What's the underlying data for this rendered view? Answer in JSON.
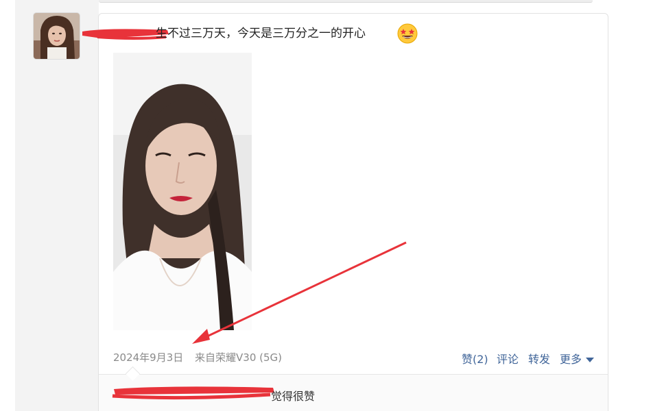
{
  "post": {
    "text_visible": "生不过三万天，今天是三万分之一的开心",
    "emoji_icon": "star-struck-emoji",
    "date": "2024年9月3日",
    "source": "来自荣耀V30 (5G)"
  },
  "actions": {
    "like": "赞(2)",
    "comment": "评论",
    "forward": "转发",
    "more": "更多"
  },
  "comment": {
    "text_visible": "觉得很赞"
  },
  "colors": {
    "accent_link": "#406599",
    "redaction": "#e8333a",
    "timeline_bg": "#f3f3f3"
  }
}
